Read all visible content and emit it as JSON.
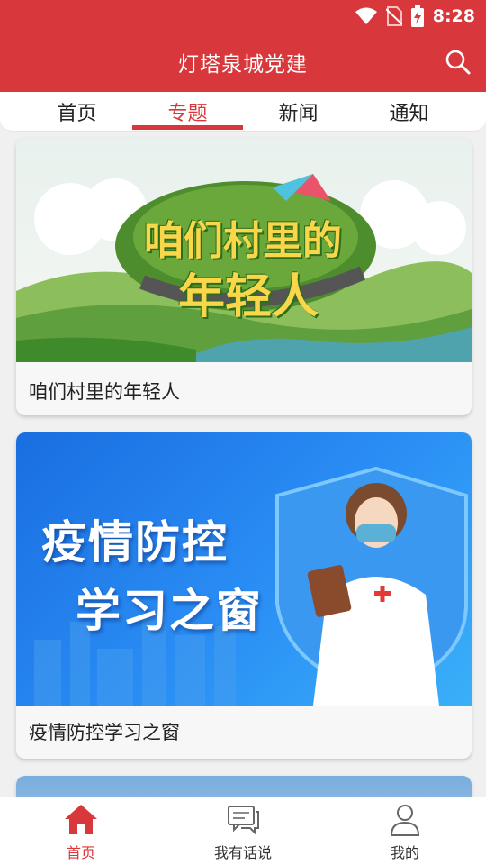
{
  "status": {
    "time": "8:28"
  },
  "header": {
    "title": "灯塔泉城党建"
  },
  "tabs": [
    {
      "label": "首页",
      "active": false
    },
    {
      "label": "专题",
      "active": true
    },
    {
      "label": "新闻",
      "active": false
    },
    {
      "label": "通知",
      "active": false
    }
  ],
  "cards": [
    {
      "title": "咱们村里的年轻人",
      "banner_text": [
        "咱们村里的",
        "年轻人"
      ]
    },
    {
      "title": "疫情防控学习之窗",
      "banner_text": [
        "疫情防控",
        "学习之窗"
      ]
    }
  ],
  "bottom_nav": [
    {
      "label": "首页",
      "icon": "home-icon",
      "active": true
    },
    {
      "label": "我有话说",
      "icon": "chat-icon",
      "active": false
    },
    {
      "label": "我的",
      "icon": "user-icon",
      "active": false
    }
  ],
  "colors": {
    "brand_red": "#d8373b",
    "tab_active": "#d8373b"
  }
}
